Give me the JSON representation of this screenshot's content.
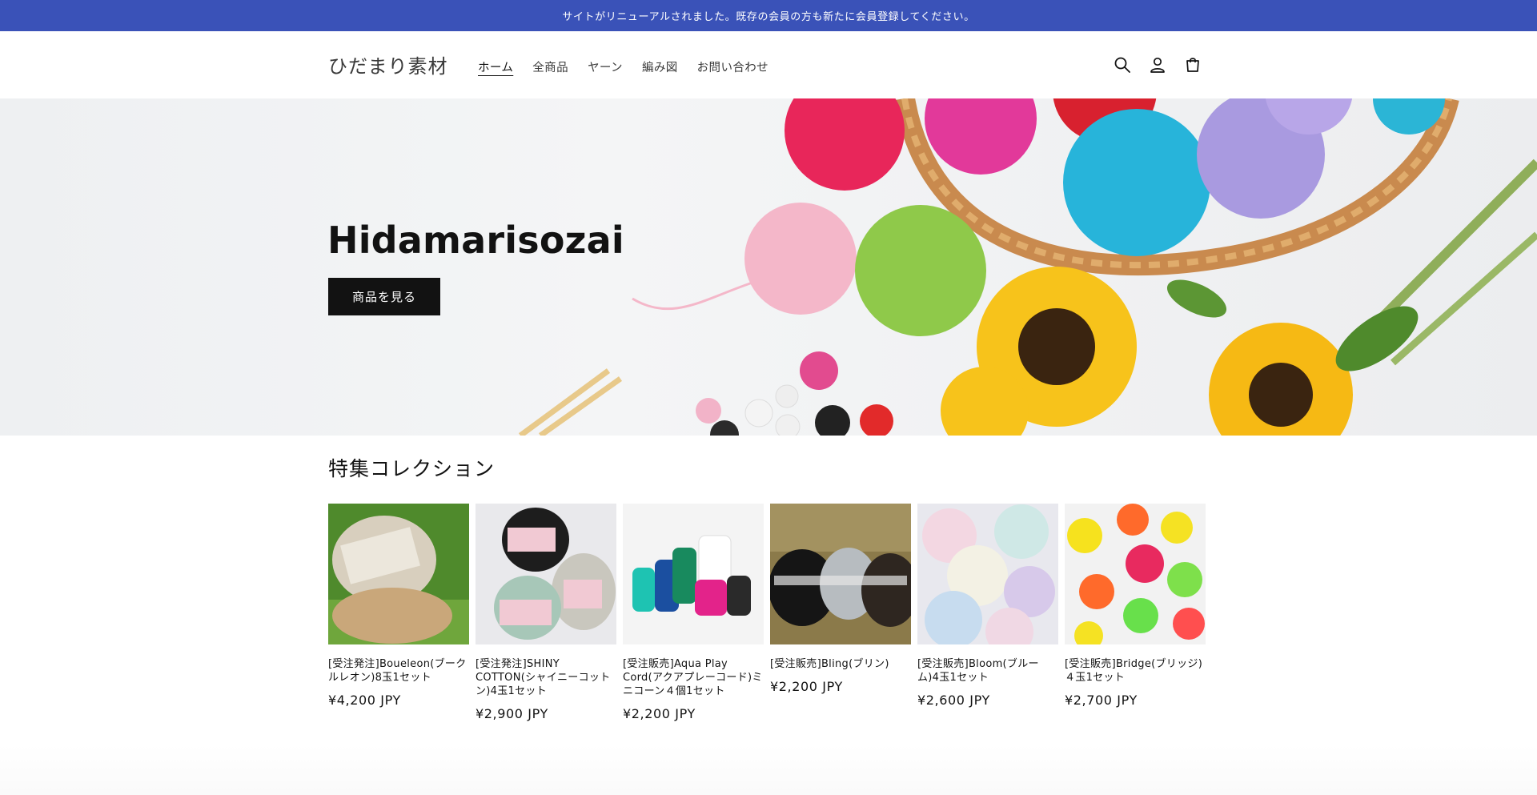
{
  "announcement": "サイトがリニューアルされました。既存の会員の方も新たに会員登録してください。",
  "header": {
    "logo": "ひだまり素材",
    "nav": [
      "ホーム",
      "全商品",
      "ヤーン",
      "編み図",
      "お問い合わせ"
    ],
    "icons": [
      "search-icon",
      "account-icon",
      "cart-icon"
    ]
  },
  "hero": {
    "title": "Hidamarisozai",
    "button": "商品を見る"
  },
  "featured": {
    "title": "特集コレクション",
    "products": [
      {
        "name": "[受注発注]Boueleon(ブークルレオン)8玉1セット",
        "price": "¥4,200 JPY"
      },
      {
        "name": "[受注発注]SHINY COTTON(シャイニーコットン)4玉1セット",
        "price": "¥2,900 JPY"
      },
      {
        "name": "[受注販売]Aqua Play Cord(アクアプレーコード)ミニコーン４個1セット",
        "price": "¥2,200 JPY"
      },
      {
        "name": "[受注販売]Bling(ブリン)",
        "price": "¥2,200 JPY"
      },
      {
        "name": "[受注販売]Bloom(ブルーム)4玉1セット",
        "price": "¥2,600 JPY"
      },
      {
        "name": "[受注販売]Bridge(ブリッジ)４玉1セット",
        "price": "¥2,700 JPY"
      }
    ]
  },
  "colors": {
    "announcement_bg": "#3a52b8",
    "button_bg": "#121212"
  }
}
